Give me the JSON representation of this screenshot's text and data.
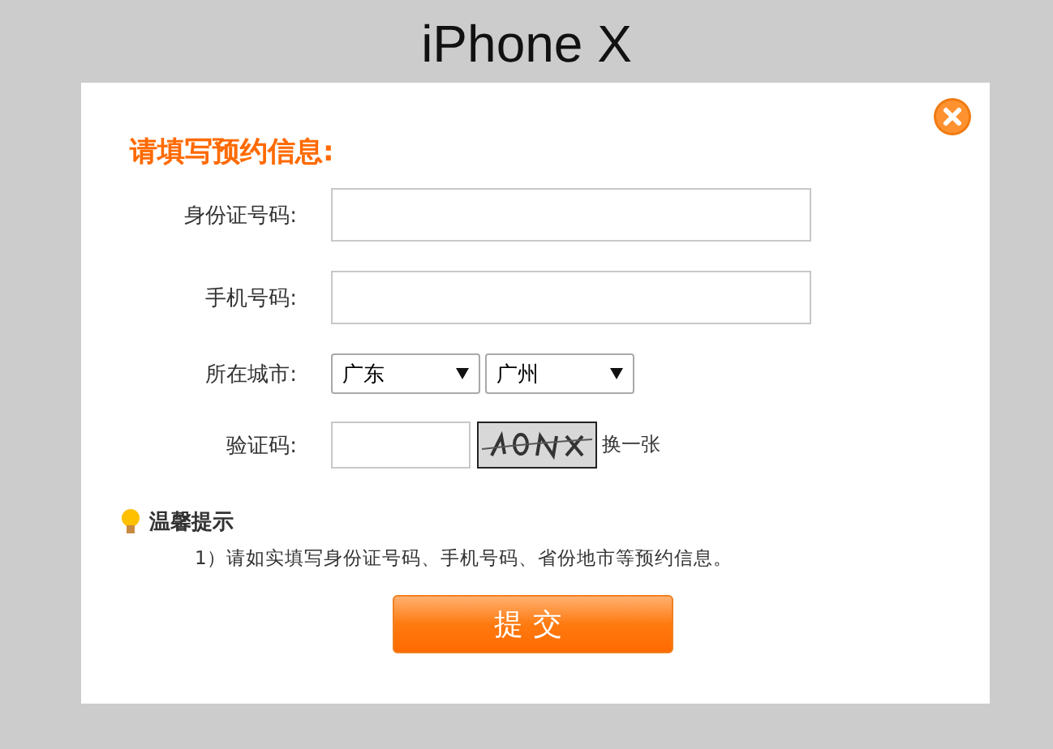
{
  "page": {
    "title": "iPhone X"
  },
  "dialog": {
    "title": "请填写预约信息:",
    "fields": [
      {
        "kind": "text",
        "label": "身份证号码:"
      },
      {
        "kind": "text",
        "label": "手机号码:"
      },
      {
        "kind": "selects",
        "label": "所在城市:",
        "selects": [
          {
            "value": "广东"
          },
          {
            "value": "广州"
          }
        ]
      },
      {
        "kind": "captcha",
        "label": "验证码:",
        "refresh": "换一张"
      }
    ],
    "tips": {
      "title": "温馨提示",
      "lines": [
        "1）请如实填写身份证号码、手机号码、省份地市等预约信息。"
      ]
    },
    "submit": "提交"
  }
}
